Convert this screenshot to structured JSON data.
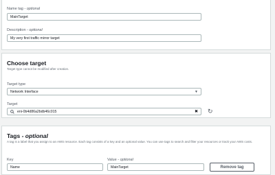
{
  "general": {
    "name_tag_label": "Name tag",
    "name_tag_optional": "- optional",
    "name_tag_value": "MainTarget",
    "description_label": "Description",
    "description_optional": "- optional",
    "description_value": "My very first traffic mirror target"
  },
  "choose_target": {
    "title": "Choose target",
    "help": "Target type cannot be modified after creation.",
    "type_label": "Target type",
    "type_value": "Network Interface",
    "target_label": "Target",
    "target_value": "eni-0b4d86a2bdb46c015",
    "clear_glyph": "✖",
    "refresh_glyph": "↻"
  },
  "tags": {
    "title": "Tags",
    "title_optional": "- optional",
    "help": "A tag is a label that you assign to an AWS resource. Each tag consists of a key and an optional value. You can use tags to search and filter your resources or track your AWS costs.",
    "key_label": "Key",
    "value_label": "Value",
    "value_optional": "- optional",
    "key_value": "Name",
    "value_value": "MainTarget",
    "remove_button": "Remove tag"
  },
  "icons": {
    "search": "search-icon",
    "caret": "caret-down-icon",
    "clear": "clear-icon",
    "refresh": "refresh-icon"
  },
  "colors": {
    "border": "#aab7b8",
    "text": "#16191f",
    "secondary": "#545b64"
  }
}
